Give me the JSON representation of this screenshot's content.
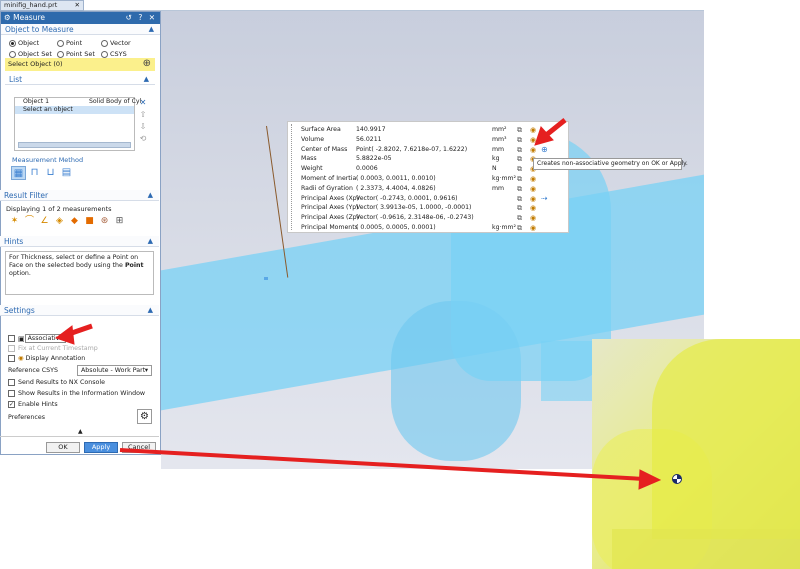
{
  "doc_tab": {
    "title": "minifig_hand.prt",
    "close": "✕"
  },
  "dialog": {
    "title": "Measure",
    "title_controls": "↺ ? ✕",
    "object_section": {
      "header": "Object to Measure",
      "radios": [
        "Object",
        "Point",
        "Vector",
        "Object Set",
        "Point Set",
        "CSYS"
      ],
      "select_label": "Select Object (0)"
    },
    "list_section": {
      "header": "List",
      "rows": [
        {
          "col1": "Object 1",
          "col2": "Solid Body of Cyl"
        },
        {
          "col1": "Select an object",
          "col2": ""
        }
      ],
      "method_label": "Measurement Method"
    },
    "filter_section": {
      "header": "Result Filter",
      "text": "Displaying 1 of 2 measurements"
    },
    "hints_section": {
      "header": "Hints",
      "text_pre": "For Thickness, select or define a Point on Face on the selected body using the ",
      "text_bold": "Point",
      "text_post": " option."
    },
    "settings_section": {
      "header": "Settings",
      "associative": "Associative",
      "fix_timestamp": "Fix at Current Timestamp",
      "display_annotation": "Display Annotation",
      "reference_csys_label": "Reference CSYS",
      "reference_csys_value": "Absolute - Work Part",
      "send_results": "Send Results to NX Console",
      "show_results": "Show Results in the Information Window",
      "enable_hints": "Enable Hints",
      "preferences": "Preferences"
    },
    "buttons": {
      "ok": "OK",
      "apply": "Apply",
      "cancel": "Cancel"
    }
  },
  "results": {
    "rows": [
      {
        "label": "Surface Area",
        "value": "140.9917",
        "unit": "mm²"
      },
      {
        "label": "Volume",
        "value": "56.0211",
        "unit": "mm³"
      },
      {
        "label": "Center of Mass",
        "value": "Point( -2.8202, 7.6218e-07, 1.6222)",
        "unit": "mm"
      },
      {
        "label": "Mass",
        "value": "5.8822e-05",
        "unit": "kg"
      },
      {
        "label": "Weight",
        "value": "0.0006",
        "unit": "N"
      },
      {
        "label": "Moment of Inertia",
        "value": "( 0.0003, 0.0011, 0.0010)",
        "unit": "kg·mm²"
      },
      {
        "label": "Radii of Gyration",
        "value": "( 2.3373, 4.4004, 4.0826)",
        "unit": "mm"
      },
      {
        "label": "Principal Axes (Xp)",
        "value": "Vector( -0.2743, 0.0001, 0.9616)",
        "unit": ""
      },
      {
        "label": "Principal Axes (Yp)",
        "value": "Vector( 3.9913e-05, 1.0000, -0.0001)",
        "unit": ""
      },
      {
        "label": "Principal Axes (Zp)",
        "value": "Vector( -0.9616, 2.3148e-06, -0.2743)",
        "unit": ""
      },
      {
        "label": "Principal Moments",
        "value": "( 0.0005, 0.0005, 0.0001)",
        "unit": "kg·mm²"
      }
    ],
    "tooltip": "Creates non-associative geometry on OK or Apply."
  },
  "colors": {
    "accent": "#2e6aac",
    "arrow": "#e52020",
    "selection": "#fbf08c"
  }
}
